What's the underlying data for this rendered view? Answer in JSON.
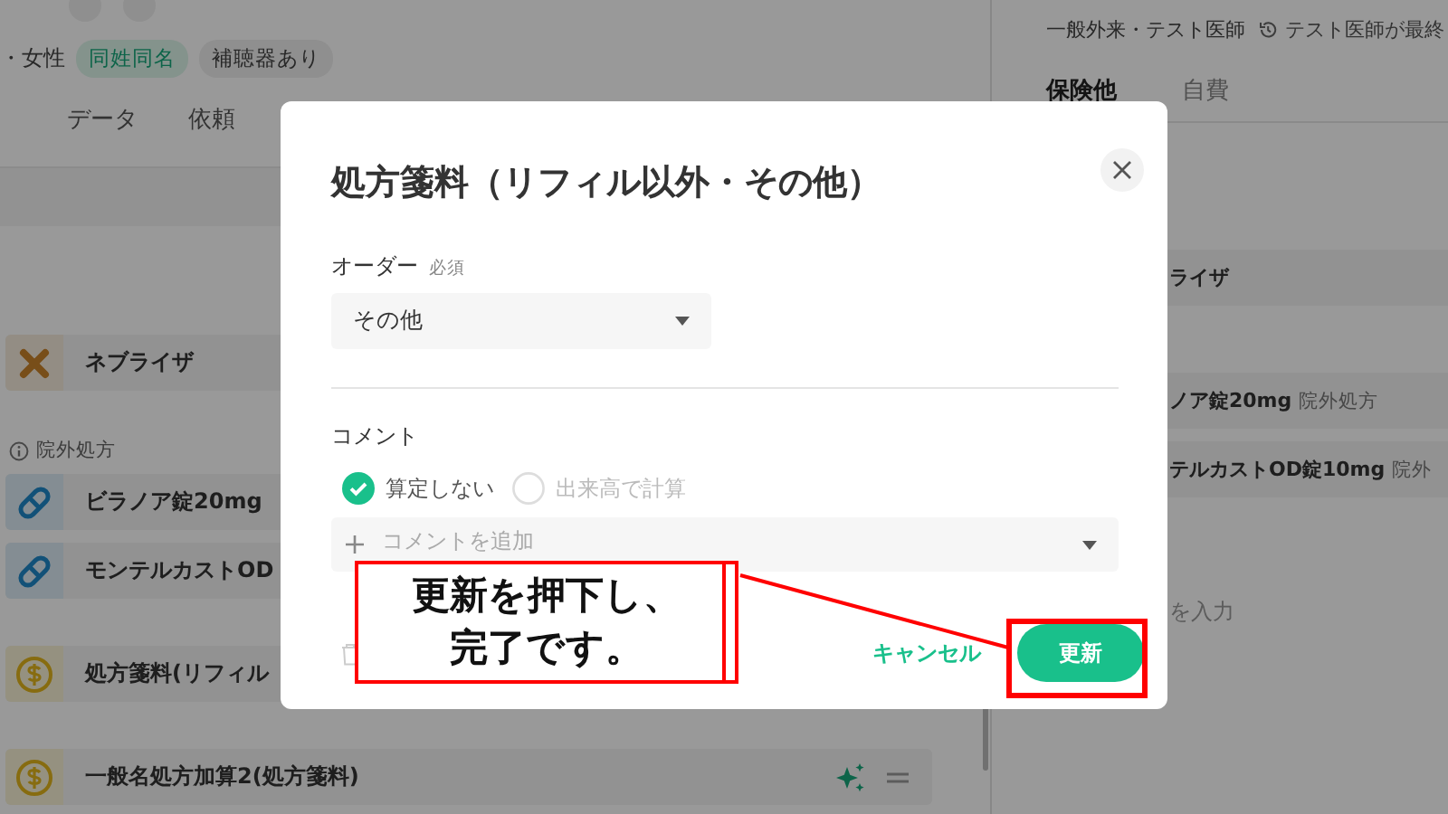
{
  "patient": {
    "demographics": "・女性",
    "tags": [
      {
        "label": "同姓同名",
        "kind": "match"
      },
      {
        "label": "補聴器あり",
        "kind": "info"
      }
    ]
  },
  "tabs": [
    {
      "label": "データ",
      "selected": false
    },
    {
      "label": "依頼",
      "selected": false
    }
  ],
  "order_groups": [
    {
      "items": [
        {
          "kind": "procedure",
          "name": "ネブライザ"
        }
      ]
    },
    {
      "label": "院外処方",
      "items": [
        {
          "kind": "drug",
          "name": "ビラノア錠20mg"
        },
        {
          "kind": "drug",
          "name": "モンテルカストOD"
        }
      ]
    },
    {
      "items": [
        {
          "kind": "fee",
          "name": "処方箋料(リフィル"
        }
      ]
    },
    {
      "items": [
        {
          "kind": "fee",
          "name": "一般名処方加算2(処方箋料)"
        }
      ]
    }
  ],
  "summary": {
    "visit": "一般外来・テスト医師",
    "history": "テスト医師が最終",
    "tabs": [
      {
        "label": "保険他",
        "selected": true
      },
      {
        "label": "自費",
        "selected": false
      }
    ],
    "items": [
      {
        "name": "ライザ"
      },
      {
        "name": "ノア錠20mg",
        "note": "院外処方"
      },
      {
        "name": "テルカストOD錠10mg",
        "note": "院外"
      }
    ],
    "placeholder": "を入力"
  },
  "dialog": {
    "title": "処方箋料（リフィル以外・その他）",
    "order_label": "オーダー",
    "required": "必須",
    "order_value": "その他",
    "comment_label": "コメント",
    "options": [
      {
        "label": "算定しない",
        "selected": true
      },
      {
        "label": "出来高で計算",
        "selected": false
      }
    ],
    "comment_placeholder": "コメントを追加",
    "cancel": "キャンセル",
    "submit": "更新"
  },
  "annotation": {
    "text": "更新を押下し、完了です。"
  }
}
